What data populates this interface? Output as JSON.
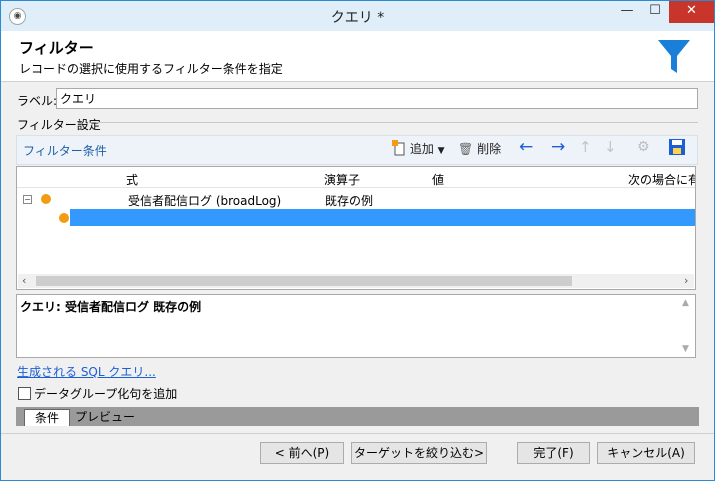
{
  "window": {
    "title": "クエリ *",
    "app_icon": "app-icon"
  },
  "header": {
    "title": "フィルター",
    "subtitle": "レコードの選択に使用するフィルター条件を指定"
  },
  "label_field": {
    "label": "ラベル:",
    "value": "クエリ"
  },
  "filter_settings": {
    "group_label": "フィルター設定",
    "bar_title": "フィルター条件",
    "add_label": "追加",
    "delete_label": "削除"
  },
  "grid": {
    "columns": [
      "式",
      "演算子",
      "値",
      "次の場合に有"
    ],
    "rows": [
      {
        "expression": "受信者配信ログ (broadLog)",
        "operator": "既存の例",
        "value": ""
      }
    ]
  },
  "summary": {
    "text": "クエリ: 受信者配信ログ 既存の例"
  },
  "sql_link": "生成される SQL クエリ...",
  "checkbox": {
    "label": "データグループ化句を追加",
    "checked": false
  },
  "tabs": [
    "条件",
    "プレビュー"
  ],
  "buttons": {
    "prev": "< 前へ(P)",
    "narrow": "ターゲットを絞り込む>",
    "finish": "完了(F)",
    "cancel": "キャンセル(A)"
  },
  "colors": {
    "accent": "#3399ff",
    "funnel": "#1a7fd8",
    "dot": "#f39c12",
    "close": "#c7352b"
  }
}
